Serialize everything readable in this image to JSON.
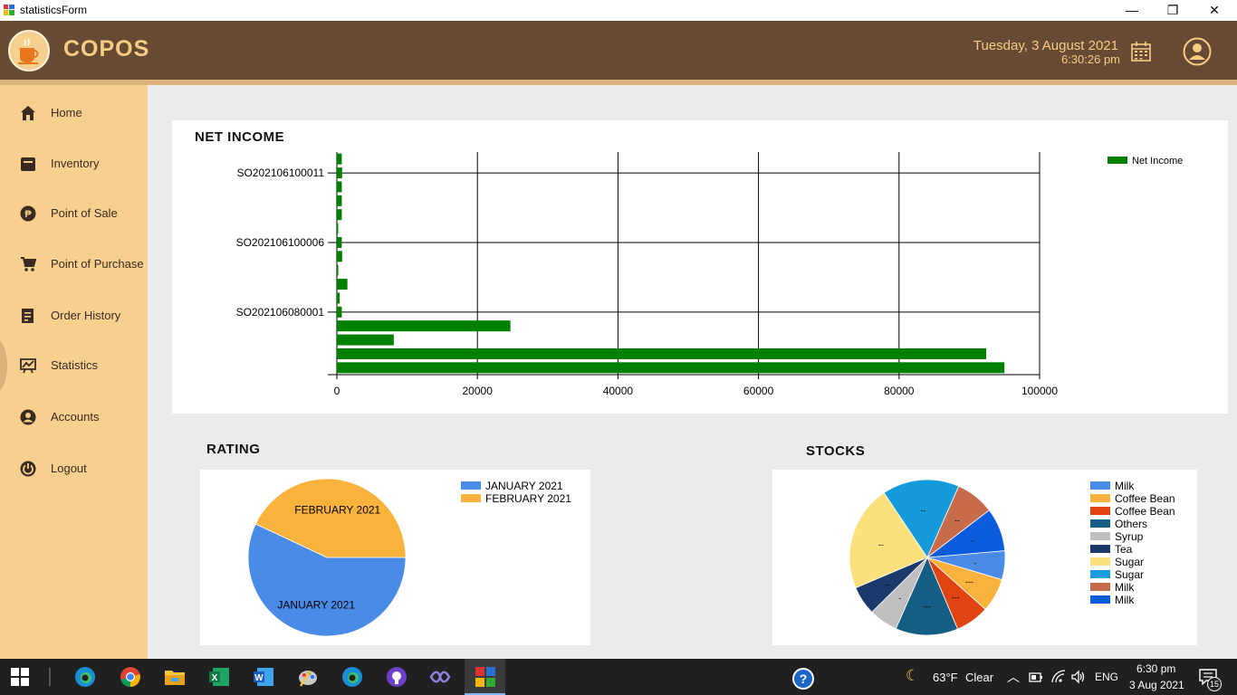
{
  "window": {
    "title": "statisticsForm",
    "minimize_glyph": "—",
    "maximize_glyph": "❐",
    "close_glyph": "✕"
  },
  "header": {
    "brand": "COPOS",
    "date": "Tuesday, 3 August 2021",
    "time": "6:30:26 pm",
    "colors": {
      "bar": "#664a33",
      "accent": "#f7cc83",
      "stripe": "#d9b37a"
    }
  },
  "sidebar": {
    "active": "Statistics",
    "items": [
      {
        "label": "Home",
        "icon": "home-icon"
      },
      {
        "label": "Inventory",
        "icon": "inventory-icon"
      },
      {
        "label": "Point of Sale",
        "icon": "peso-coin-icon"
      },
      {
        "label": "Point of Purchase",
        "icon": "cart-icon"
      },
      {
        "label": "Order History",
        "icon": "receipt-icon"
      },
      {
        "label": "Statistics",
        "icon": "chart-icon"
      },
      {
        "label": "Accounts",
        "icon": "account-icon"
      },
      {
        "label": "Logout",
        "icon": "power-icon"
      }
    ]
  },
  "net_income": {
    "title": "NET INCOME"
  },
  "rating": {
    "title": "RATING"
  },
  "stocks": {
    "title": "STOCKS"
  },
  "chart_data": [
    {
      "type": "bar",
      "orientation": "horizontal",
      "title": "NET INCOME",
      "series": [
        {
          "name": "Net Income",
          "color": "#008000",
          "values": [
            700,
            750,
            700,
            700,
            700,
            150,
            700,
            750,
            200,
            1500,
            400,
            700,
            24700,
            8100,
            92400,
            95000
          ]
        }
      ],
      "category_tick_labels": [
        {
          "label": "SO202106100011",
          "index": 1
        },
        {
          "label": "SO202106100006",
          "index": 6
        },
        {
          "label": "SO202106080001",
          "index": 11
        }
      ],
      "xlim": [
        0,
        100000
      ],
      "xticks": [
        "0",
        "20000",
        "40000",
        "60000",
        "80000",
        "100000"
      ],
      "grid": true,
      "legend": "top-right"
    },
    {
      "type": "pie",
      "title": "RATING",
      "slices": [
        {
          "label": "JANUARY 2021",
          "value": 57,
          "color": "#4a8be8"
        },
        {
          "label": "FEBRUARY 2021",
          "value": 43,
          "color": "#f9b23b"
        }
      ],
      "legend": "top-right"
    },
    {
      "type": "pie",
      "title": "STOCKS",
      "slices": [
        {
          "label": "Milk",
          "value": 6,
          "color": "#4a8be8",
          "data_label": "-"
        },
        {
          "label": "Coffee Bean",
          "value": 7,
          "color": "#f9b23b",
          "data_label": "---"
        },
        {
          "label": "Coffee Bean",
          "value": 7,
          "color": "#e04412",
          "data_label": "---"
        },
        {
          "label": "Others",
          "value": 13,
          "color": "#135e82",
          "data_label": "---"
        },
        {
          "label": "Syrup",
          "value": 6,
          "color": "#bfbfbf",
          "data_label": "-"
        },
        {
          "label": "Tea",
          "value": 6,
          "color": "#1b3a6b",
          "data_label": "--"
        },
        {
          "label": "Sugar",
          "value": 22,
          "color": "#fde07e",
          "data_label": "--"
        },
        {
          "label": "Sugar",
          "value": 16,
          "color": "#159bd9",
          "data_label": "--"
        },
        {
          "label": "Milk",
          "value": 8,
          "color": "#c86b4a",
          "data_label": "--"
        },
        {
          "label": "Milk",
          "value": 9,
          "color": "#0b5bdd",
          "data_label": "-"
        }
      ],
      "legend": "top-right"
    }
  ],
  "taskbar": {
    "weather_temp": "63°F",
    "weather_text": "Clear",
    "language": "ENG",
    "clock_time": "6:30 pm",
    "clock_date": "3 Aug 2021",
    "notification_count": "15"
  }
}
